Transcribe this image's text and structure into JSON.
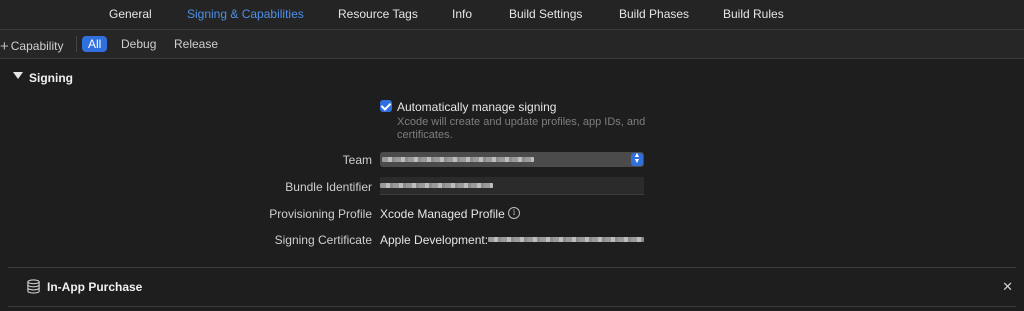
{
  "tabs": [
    {
      "label": "General",
      "active": false
    },
    {
      "label": "Signing & Capabilities",
      "active": true
    },
    {
      "label": "Resource Tags",
      "active": false
    },
    {
      "label": "Info",
      "active": false
    },
    {
      "label": "Build Settings",
      "active": false
    },
    {
      "label": "Build Phases",
      "active": false
    },
    {
      "label": "Build Rules",
      "active": false
    }
  ],
  "filter_bar": {
    "add_capability_label": "Capability",
    "filters": [
      {
        "label": "All",
        "selected": true
      },
      {
        "label": "Debug",
        "selected": false
      },
      {
        "label": "Release",
        "selected": false
      }
    ]
  },
  "signing": {
    "title": "Signing",
    "auto_manage_label": "Automatically manage signing",
    "auto_manage_checked": true,
    "auto_manage_help": "Xcode will create and update profiles, app IDs, and certificates.",
    "team_label": "Team",
    "bundle_id_label": "Bundle Identifier",
    "profile_label": "Provisioning Profile",
    "profile_value": "Xcode Managed Profile",
    "certificate_label": "Signing Certificate",
    "certificate_value": "Apple Development:"
  },
  "in_app_purchase": {
    "title": "In-App Purchase"
  },
  "colors": {
    "accent": "#2f6fde",
    "active_tab": "#4f8fe8",
    "background": "#1e1e1e"
  },
  "icons": [
    "plus-icon",
    "disclosure-triangle-icon",
    "checkmark-icon",
    "stepper-icon",
    "info-icon",
    "database-icon",
    "close-icon"
  ]
}
